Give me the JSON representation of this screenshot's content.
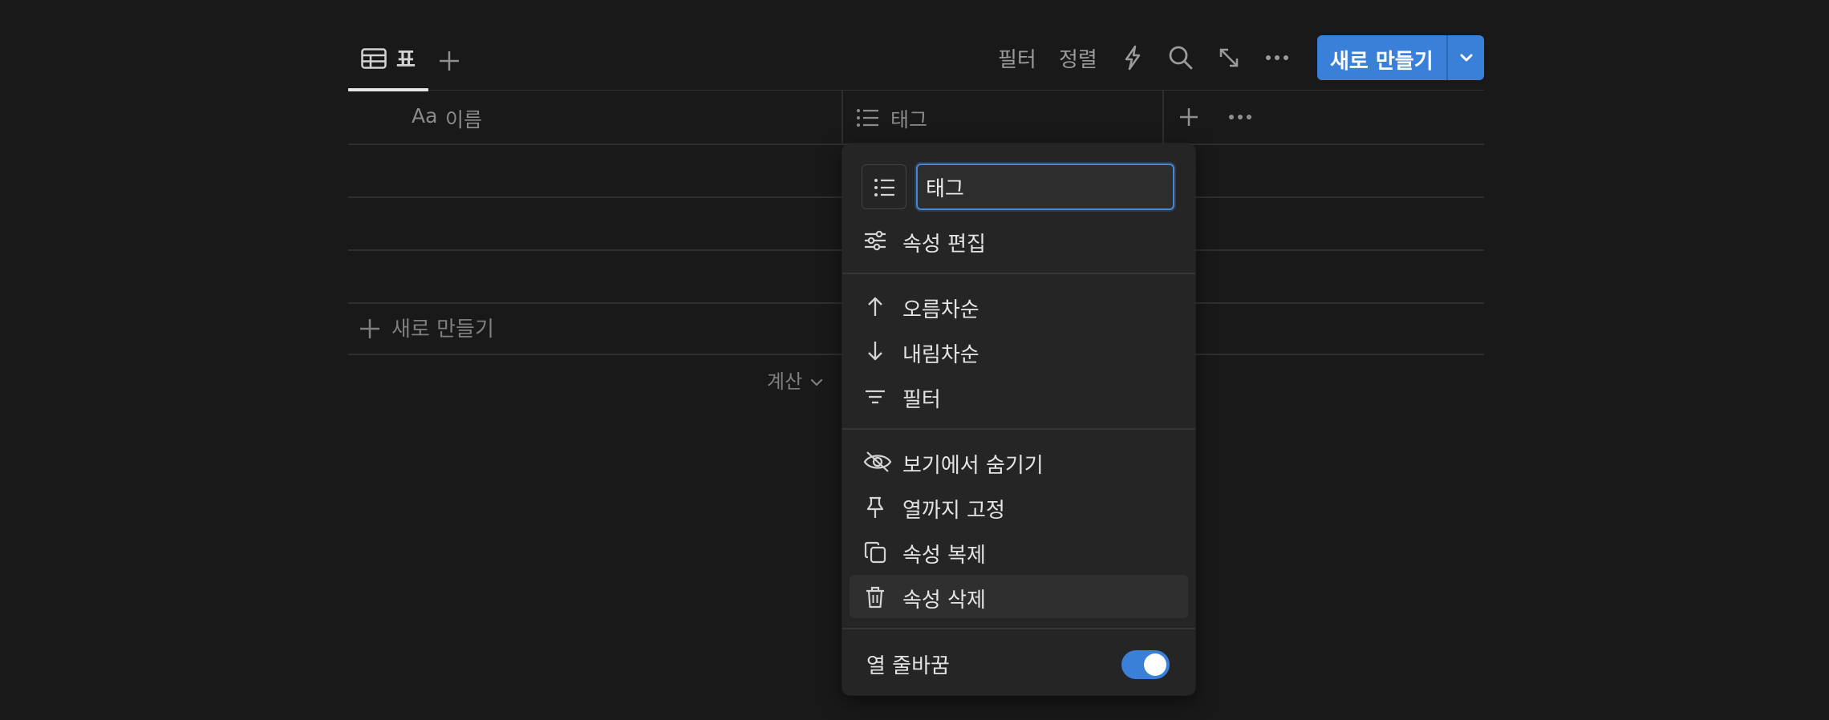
{
  "view_tabs": {
    "active_tab_label": "표",
    "add_view_icon": "plus-icon"
  },
  "toolbar": {
    "filter_label": "필터",
    "sort_label": "정렬",
    "automation_icon": "lightning-icon",
    "search_icon": "search-icon",
    "expand_icon": "expand-icon",
    "more_icon": "more-horizontal-icon",
    "new_button_label": "새로 만들기"
  },
  "table": {
    "columns": [
      {
        "icon_text": "Aa",
        "label": "이름"
      },
      {
        "icon": "list-icon",
        "label": "태그"
      }
    ],
    "new_row_label": "새로 만들기",
    "calculate_label": "계산"
  },
  "property_menu": {
    "property_type_icon": "list-icon",
    "name_value": "태그",
    "items_group1": [
      {
        "icon": "sliders-icon",
        "label": "속성 편집"
      }
    ],
    "items_group2": [
      {
        "icon": "arrow-up-icon",
        "label": "오름차순"
      },
      {
        "icon": "arrow-down-icon",
        "label": "내림차순"
      },
      {
        "icon": "filter-icon",
        "label": "필터"
      }
    ],
    "items_group3": [
      {
        "icon": "eye-off-icon",
        "label": "보기에서 숨기기"
      },
      {
        "icon": "pin-icon",
        "label": "열까지 고정"
      },
      {
        "icon": "duplicate-icon",
        "label": "속성 복제"
      },
      {
        "icon": "trash-icon",
        "label": "속성 삭제"
      }
    ],
    "wrap_column_label": "열 줄바꿈",
    "wrap_column_enabled": true
  },
  "colors": {
    "background": "#191919",
    "accent": "#3a7fd8",
    "menu_bg": "#252525"
  }
}
